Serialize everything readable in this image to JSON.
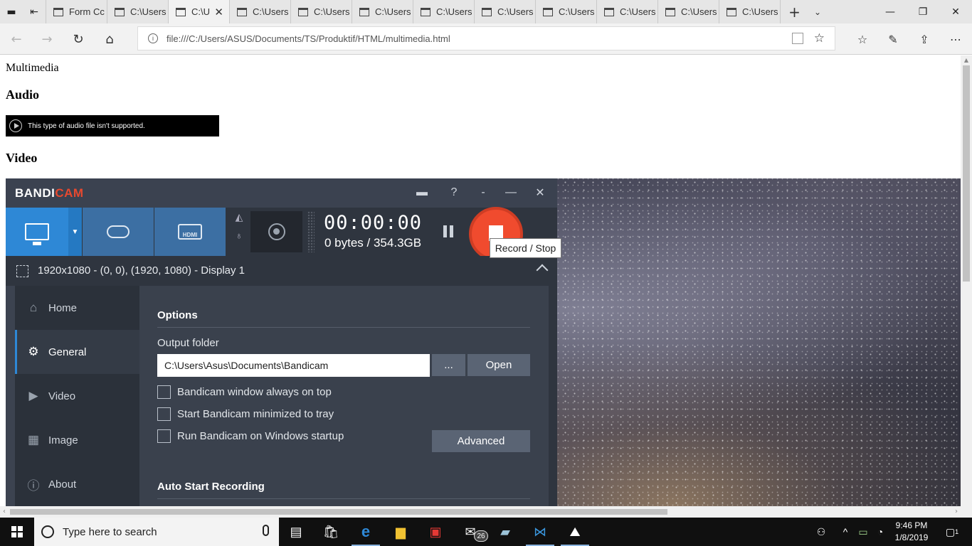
{
  "browser": {
    "tabs": [
      {
        "label": "Form Cc",
        "active": false
      },
      {
        "label": "C:\\Users",
        "active": false
      },
      {
        "label": "C:\\U",
        "active": true
      },
      {
        "label": "C:\\Users",
        "active": false
      },
      {
        "label": "C:\\Users",
        "active": false
      },
      {
        "label": "C:\\Users",
        "active": false
      },
      {
        "label": "C:\\Users",
        "active": false
      },
      {
        "label": "C:\\Users",
        "active": false
      },
      {
        "label": "C:\\Users",
        "active": false
      },
      {
        "label": "C:\\Users",
        "active": false
      },
      {
        "label": "C:\\Users",
        "active": false
      },
      {
        "label": "C:\\Users",
        "active": false
      }
    ],
    "url": "file:///C:/Users/ASUS/Documents/TS/Produktif/HTML/multimedia.html"
  },
  "page": {
    "title": "Multimedia",
    "audio_heading": "Audio",
    "audio_message": "This type of audio file isn't supported.",
    "video_heading": "Video"
  },
  "bandicam": {
    "logo_a": "BANDI",
    "logo_b": "CAM",
    "hdmi_label": "HDMI",
    "timer": "00:00:00",
    "bytes": "0 bytes / 354.3GB",
    "tooltip": "Record / Stop",
    "target": "1920x1080 - (0, 0), (1920, 1080) - Display 1",
    "menu": [
      {
        "label": "Home",
        "icon": "home-icon"
      },
      {
        "label": "General",
        "icon": "gear-icon"
      },
      {
        "label": "Video",
        "icon": "video-icon"
      },
      {
        "label": "Image",
        "icon": "image-icon"
      },
      {
        "label": "About",
        "icon": "info-icon"
      }
    ],
    "options_title": "Options",
    "output_folder_label": "Output folder",
    "output_folder_value": "C:\\Users\\Asus\\Documents\\Bandicam",
    "browse_label": "...",
    "open_label": "Open",
    "checkboxes": [
      {
        "label": "Bandicam window always on top",
        "checked": false
      },
      {
        "label": "Start Bandicam minimized to tray",
        "checked": false
      },
      {
        "label": "Run Bandicam on Windows startup",
        "checked": false
      }
    ],
    "advanced_label": "Advanced",
    "auto_start_title": "Auto Start Recording"
  },
  "taskbar": {
    "search_placeholder": "Type here to search",
    "mail_badge": "26",
    "time": "9:46 PM",
    "date": "1/8/2019",
    "notification_count": "1"
  }
}
